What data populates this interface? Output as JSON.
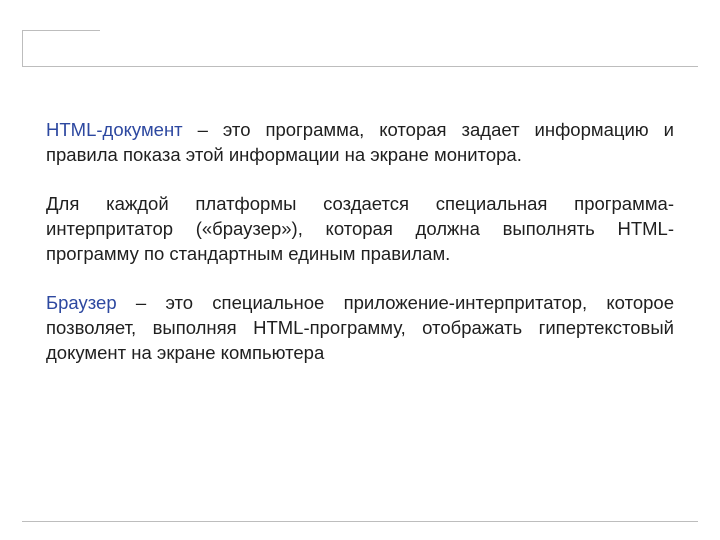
{
  "content": {
    "term1": "HTML-документ",
    "p1_rest": " – это программа, которая задает информацию и правила показа этой информации на экране монитора.",
    "p2": "Для каждой платформы создается специальная программа-интерпритатор («браузер»), которая должна выполнять HTML-программу по стандартным единым правилам.",
    "term2": "Браузер",
    "p3_rest": " – это специальное приложение-интерпритатор, которое позволяет, выполняя HTML-программу, отображать гипертекстовый документ на экране компьютера"
  },
  "colors": {
    "term": "#2d48a0",
    "text": "#1f1f1f",
    "rule": "#bdbdbd"
  }
}
